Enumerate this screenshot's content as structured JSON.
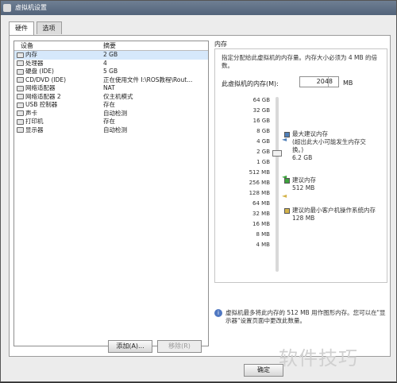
{
  "window": {
    "title": "虚拟机设置"
  },
  "tabs": [
    {
      "label": "硬件"
    },
    {
      "label": "选项"
    }
  ],
  "devices": {
    "headers": {
      "device": "设备",
      "summary": "摘要"
    },
    "rows": [
      {
        "name": "内存",
        "summary": "2 GB",
        "icon": "memory-icon"
      },
      {
        "name": "处理器",
        "summary": "4",
        "icon": "processor-icon"
      },
      {
        "name": "硬盘 (IDE)",
        "summary": "5 GB",
        "icon": "hard-disk-icon"
      },
      {
        "name": "CD/DVD (IDE)",
        "summary": "正在使用文件 I:\\ROS教程\\Rout...",
        "icon": "cd-dvd-icon"
      },
      {
        "name": "网络适配器",
        "summary": "NAT",
        "icon": "network-adapter-icon"
      },
      {
        "name": "网络适配器 2",
        "summary": "仅主机模式",
        "icon": "network-adapter-icon"
      },
      {
        "name": "USB 控制器",
        "summary": "存在",
        "icon": "usb-controller-icon"
      },
      {
        "name": "声卡",
        "summary": "自动检测",
        "icon": "sound-card-icon"
      },
      {
        "name": "打印机",
        "summary": "存在",
        "icon": "printer-icon"
      },
      {
        "name": "显示器",
        "summary": "自动检测",
        "icon": "display-icon"
      }
    ],
    "add_button": "添加(A)...",
    "remove_button": "移除(R)"
  },
  "memory": {
    "title": "内存",
    "description": "指定分配给此虚拟机的内存量。内存大小必须为 4 MB 的倍数。",
    "label": "此虚拟机的内存(M):",
    "value": "2048",
    "unit": "MB",
    "scale": [
      "64 GB",
      "32 GB",
      "16 GB",
      "8 GB",
      "4 GB",
      "2 GB",
      "1 GB",
      "512 MB",
      "256 MB",
      "128 MB",
      "64 MB",
      "32 MB",
      "16 MB",
      "8 MB",
      "4 MB"
    ],
    "legend": [
      {
        "label": "最大建议内存",
        "note": "(超出此大小可能发生内存交换。)",
        "value": "6.2 GB",
        "color": "#4f7fb8"
      },
      {
        "label": "建议内存",
        "value": "512 MB",
        "color": "#3da43d"
      },
      {
        "label": "建议的最小客户机操作系统内存",
        "value": "128 MB",
        "color": "#d4b34a"
      }
    ],
    "info": "虚拟机最多将此内存的 512 MB 用作图形内存。您可以在\"显示器\"设置页面中更改此数量。"
  },
  "footer": {
    "ok_button": "确定"
  },
  "watermark": "软件技巧"
}
